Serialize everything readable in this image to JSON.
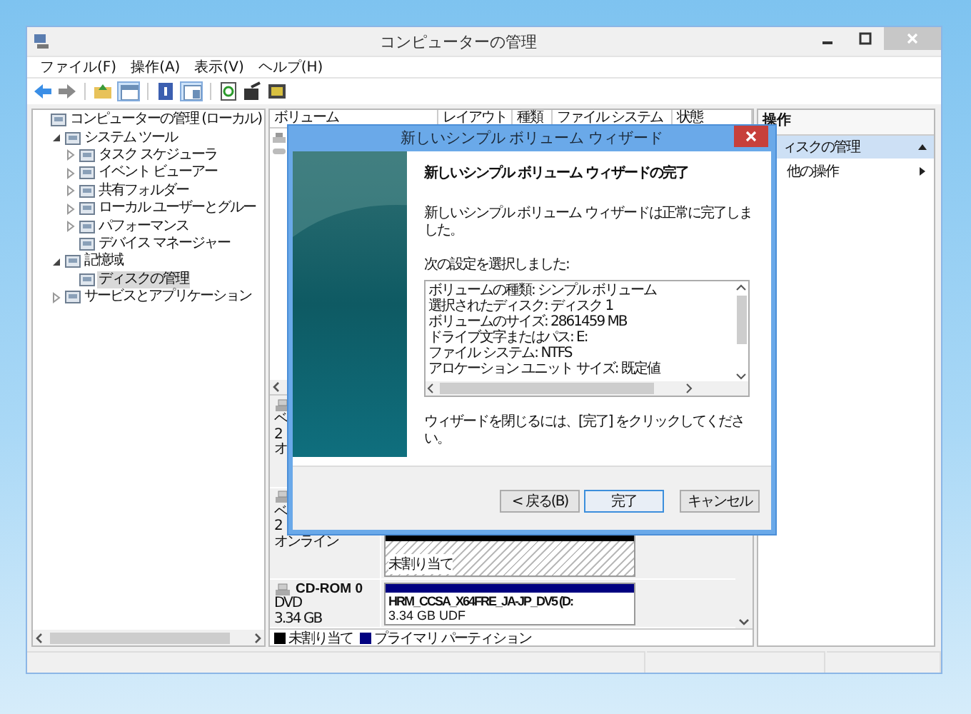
{
  "window": {
    "title": "コンピューターの管理"
  },
  "menu": [
    "ファイル(F)",
    "操作(A)",
    "表示(V)",
    "ヘルプ(H)"
  ],
  "tree": [
    {
      "label": "コンピューターの管理 (ローカル)",
      "selected": false,
      "children": [
        {
          "label": "システム ツール",
          "expanded": true,
          "selected": false,
          "children": [
            {
              "label": "タスク スケジューラ",
              "expanded": false,
              "selected": false
            },
            {
              "label": "イベント ビューアー",
              "expanded": false,
              "selected": false
            },
            {
              "label": "共有フォルダー",
              "expanded": false,
              "selected": false
            },
            {
              "label": "ローカル ユーザーとグルー",
              "expanded": false,
              "selected": false
            },
            {
              "label": "パフォーマンス",
              "expanded": false,
              "selected": false
            },
            {
              "label": "デバイス マネージャー",
              "selected": false
            }
          ]
        },
        {
          "label": "記憶域",
          "expanded": true,
          "selected": false,
          "children": [
            {
              "label": "ディスクの管理",
              "selected": true
            }
          ]
        },
        {
          "label": "サービスとアプリケーション",
          "expanded": false,
          "selected": false
        }
      ]
    }
  ],
  "columns": [
    "ボリューム",
    "レイアウト",
    "種類",
    "ファイル システム",
    "状態"
  ],
  "disks": [
    {
      "lines": [
        "ベ",
        "2",
        "オ"
      ]
    },
    {
      "lines": [
        "ベ",
        "2",
        "オンライン"
      ],
      "partition": {
        "kind": "unallocated",
        "label": "未割り当て"
      }
    },
    {
      "name": "CD-ROM 0",
      "lines": [
        "DVD",
        "3.34 GB"
      ],
      "partition": {
        "kind": "primary",
        "label": "HRM_CCSA_X64FRE_JA-JP_DV5 (D:",
        "lines": [
          "3.34 GB UDF"
        ]
      }
    }
  ],
  "legend": [
    {
      "label": "未割り当て",
      "color": "#000000"
    },
    {
      "label": "プライマリ パーティション",
      "color": "#000080"
    }
  ],
  "actions": {
    "header": "操作",
    "section": "ィスクの管理",
    "items": [
      "他の操作"
    ]
  },
  "wizard": {
    "title": "新しいシンプル ボリューム ウィザード",
    "heading": "新しいシンプル ボリューム ウィザードの完了",
    "message": "新しいシンプル ボリューム ウィザードは正常に完了しました。",
    "settings_label": "次の設定を選択しました:",
    "settings": [
      "ボリュームの種類: シンプル ボリューム",
      "選択されたディスク: ディスク 1",
      "ボリュームのサイズ: 2861459 MB",
      "ドライブ文字またはパス: E:",
      "ファイル システム: NTFS",
      "アロケーション ユニット サイズ: 既定値"
    ],
    "footer_note": "ウィザードを閉じるには、[完了] をクリックしてください。",
    "buttons": [
      {
        "label": "< 戻る(B)",
        "default": false
      },
      {
        "label": "完了",
        "default": true
      },
      {
        "label": "キャンセル",
        "default": false
      }
    ]
  }
}
